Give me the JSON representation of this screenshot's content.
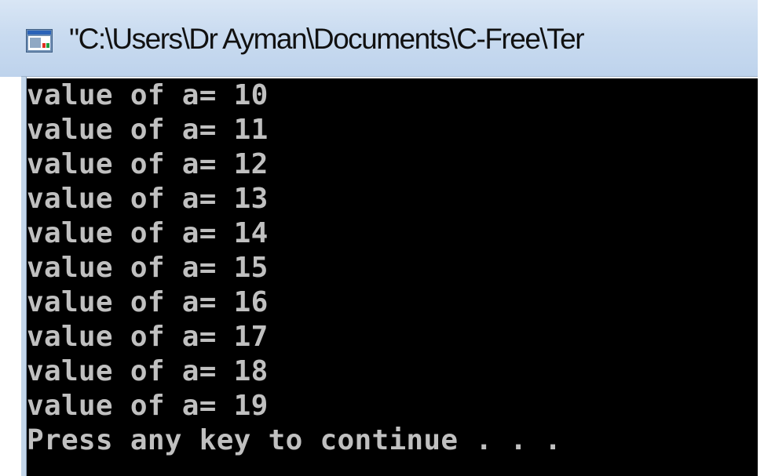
{
  "window": {
    "title": "\"C:\\Users\\Dr Ayman\\Documents\\C-Free\\Ter",
    "icon": "console-app-icon"
  },
  "console": {
    "background": "#000000",
    "text_color": "#c0c0c0",
    "lines": [
      "value of a= 10",
      "value of a= 11",
      "value of a= 12",
      "value of a= 13",
      "value of a= 14",
      "value of a= 15",
      "value of a= 16",
      "value of a= 17",
      "value of a= 18",
      "value of a= 19",
      "Press any key to continue . . ."
    ]
  }
}
